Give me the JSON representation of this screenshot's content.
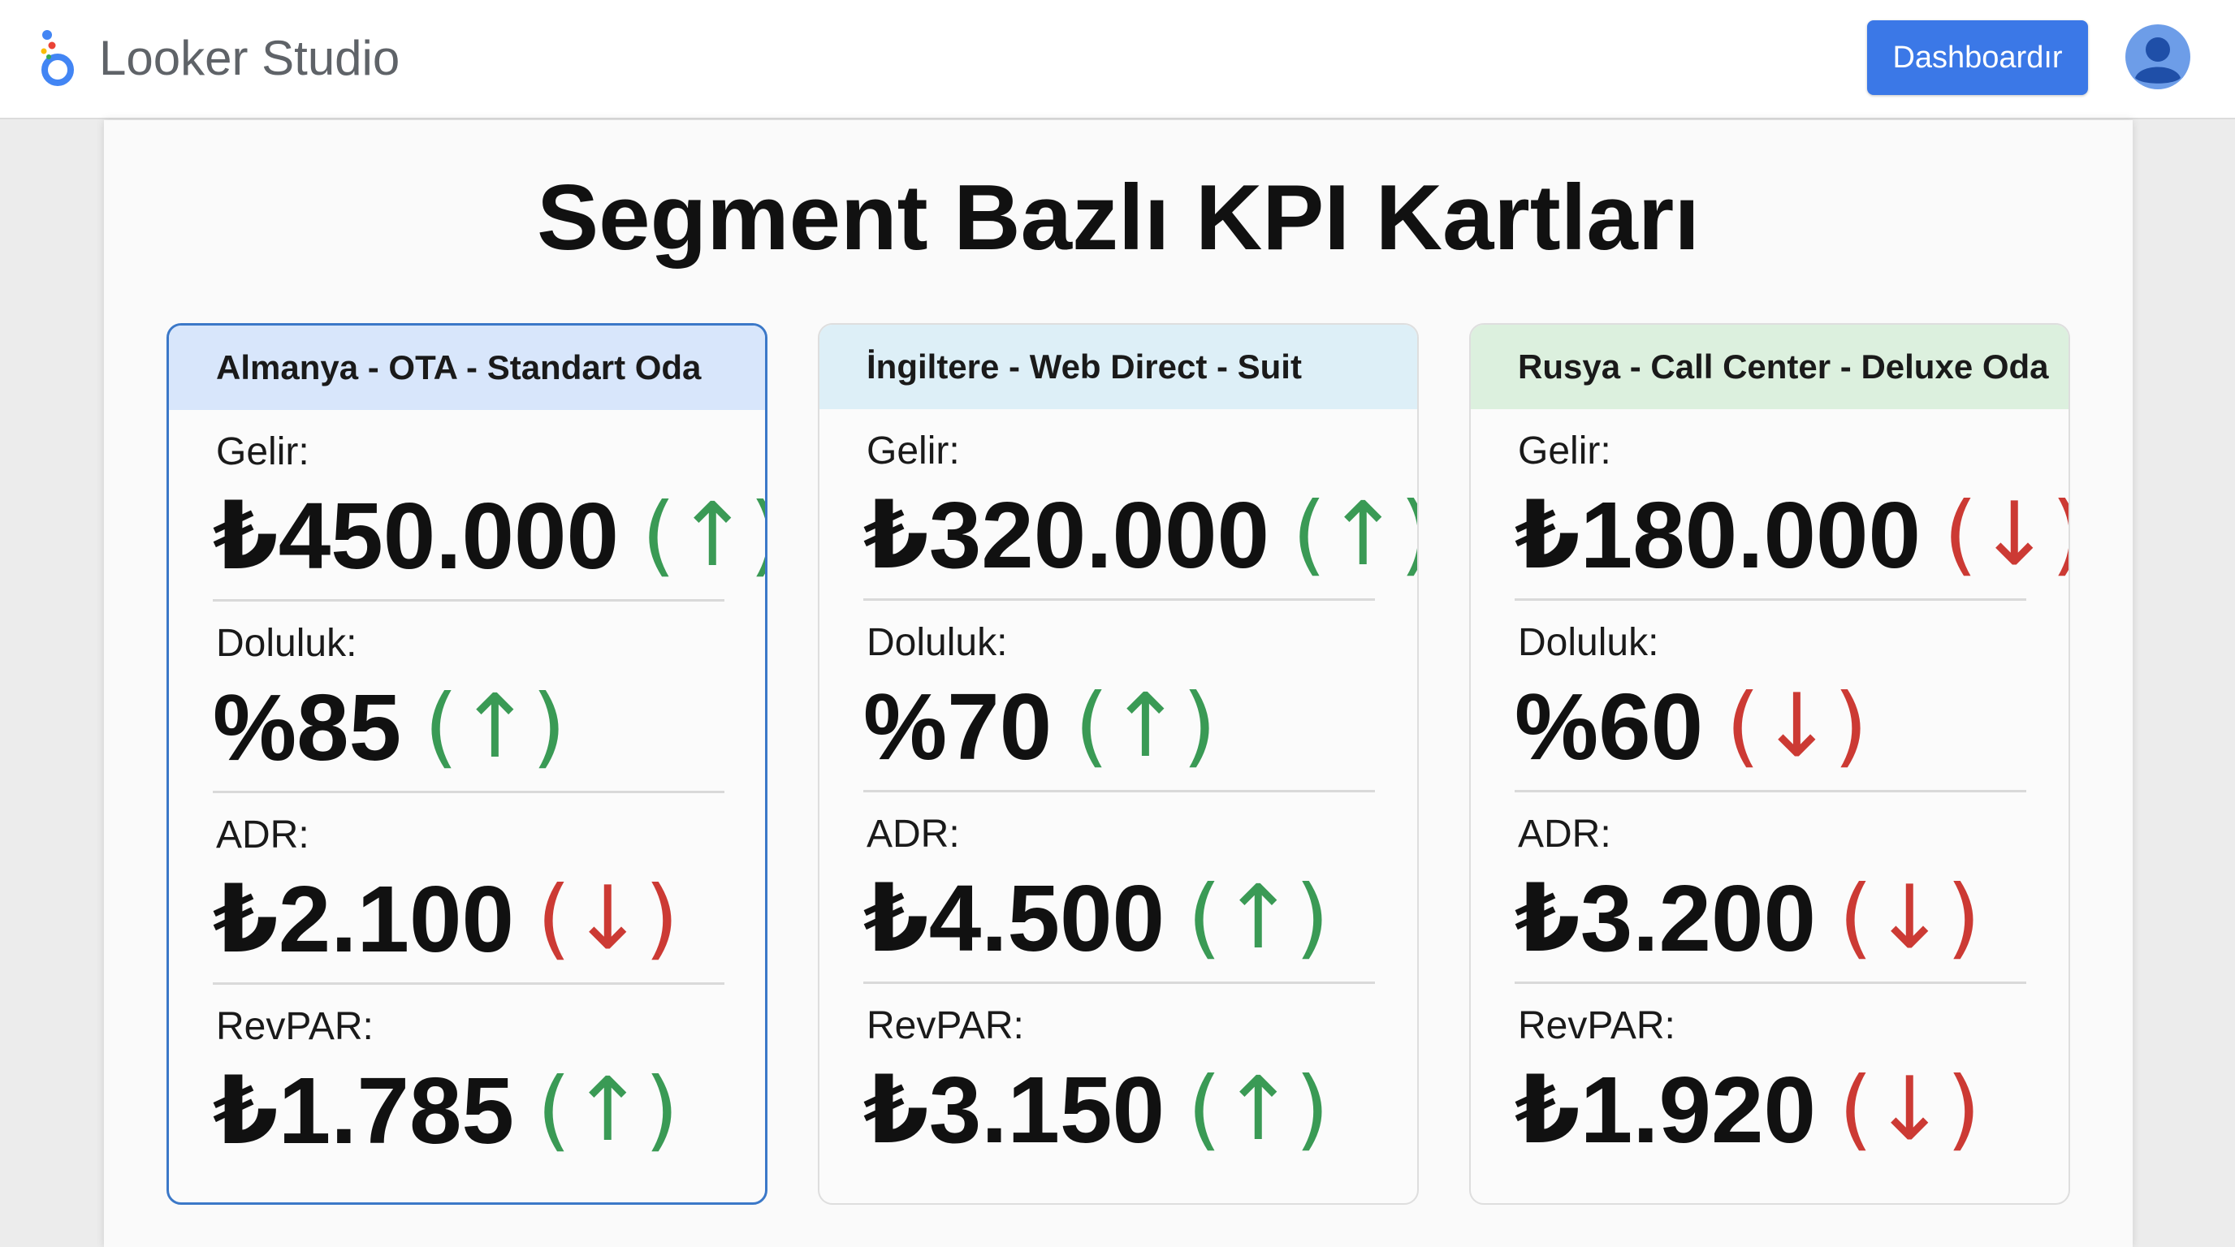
{
  "app": {
    "name": "Looker Studio",
    "logo_icon": "looker-studio-logo-icon",
    "dashboard_button": "Dashboardır",
    "avatar_icon": "user-avatar-icon"
  },
  "page": {
    "title": "Segment Bazlı KPI Kartları"
  },
  "colors": {
    "up": "#3a9a55",
    "down": "#cc3a34",
    "button": "#3b78e7",
    "selected_border": "#3b78c8"
  },
  "cards": [
    {
      "title": "Almanya - OTA - Standart Oda",
      "header_color": "#d8e6fb",
      "selected": true,
      "metrics": [
        {
          "label": "Gelir:",
          "value": "₺450.000",
          "trend": "(↑)",
          "direction": "up"
        },
        {
          "label": "Doluluk:",
          "value": "%85",
          "trend": "(↑)",
          "direction": "up"
        },
        {
          "label": "ADR:",
          "value": "₺2.100",
          "trend": "(↓)",
          "direction": "down"
        },
        {
          "label": "RevPAR:",
          "value": "₺1.785",
          "trend": "(↑)",
          "direction": "up"
        }
      ]
    },
    {
      "title": "İngiltere - Web Direct - Suit",
      "header_color": "#ddeff7",
      "selected": false,
      "metrics": [
        {
          "label": "Gelir:",
          "value": "₺320.000",
          "trend": "(↑)",
          "direction": "up"
        },
        {
          "label": "Doluluk:",
          "value": "%70",
          "trend": "(↑)",
          "direction": "up"
        },
        {
          "label": "ADR:",
          "value": "₺4.500",
          "trend": "(↑)",
          "direction": "up"
        },
        {
          "label": "RevPAR:",
          "value": "₺3.150",
          "trend": "(↑)",
          "direction": "up"
        }
      ]
    },
    {
      "title": "Rusya - Call Center - Deluxe Oda",
      "header_color": "#dcf0de",
      "selected": false,
      "metrics": [
        {
          "label": "Gelir:",
          "value": "₺180.000",
          "trend": "(↓)",
          "direction": "down"
        },
        {
          "label": "Doluluk:",
          "value": "%60",
          "trend": "(↓)",
          "direction": "down"
        },
        {
          "label": "ADR:",
          "value": "₺3.200",
          "trend": "(↓)",
          "direction": "down"
        },
        {
          "label": "RevPAR:",
          "value": "₺1.920",
          "trend": "(↓)",
          "direction": "down"
        }
      ]
    }
  ]
}
